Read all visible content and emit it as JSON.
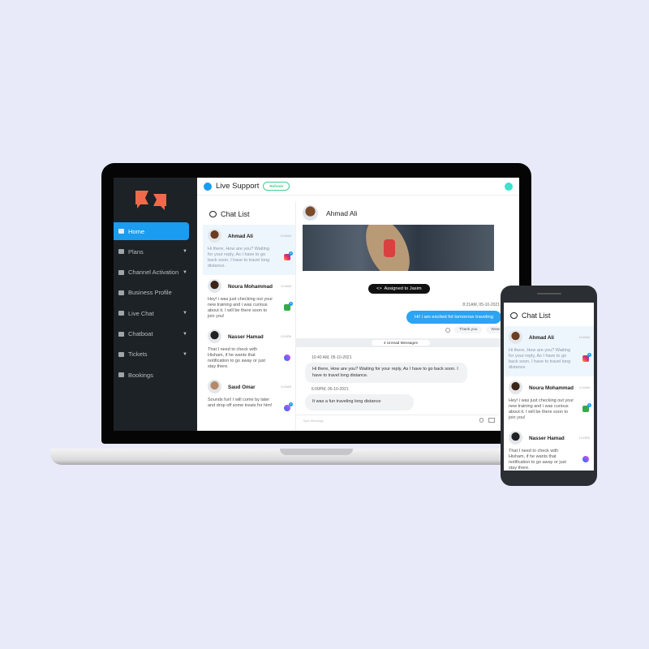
{
  "app": {
    "title": "Live Support",
    "refresh_label": "Refresh",
    "brand_color": "#1a9cf0",
    "logo_color": "#ef6a4a"
  },
  "sidebar": {
    "items": [
      {
        "label": "Home",
        "icon": "home-icon",
        "active": true,
        "caret": false
      },
      {
        "label": "Plans",
        "icon": "list-icon",
        "caret": true
      },
      {
        "label": "Channel Activation",
        "icon": "asterisk-icon",
        "caret": true
      },
      {
        "label": "Business Profile",
        "icon": "user-icon",
        "caret": false
      },
      {
        "label": "Live Chat",
        "icon": "chat-icon",
        "caret": true
      },
      {
        "label": "Chatboat",
        "icon": "list-icon",
        "caret": true
      },
      {
        "label": "Tickets",
        "icon": "ticket-icon",
        "caret": true
      },
      {
        "label": "Bookings",
        "icon": "tag-icon",
        "caret": false
      }
    ]
  },
  "chat_list": {
    "title": "Chat List",
    "items": [
      {
        "name": "Ahmad Ali",
        "time": "10:40AM",
        "message": "Hi there, How are you? Waiting for your reply, As I have to go back soon.  I have to travel long distance.",
        "channel": "instagram",
        "badge": "4",
        "selected": true,
        "avatar_color": "#6b3d22"
      },
      {
        "name": "Noura Mohammad",
        "time": "11:40AM",
        "message": "Hey! i was just checking out your new training and i was curious about it. I will be there soon to join you!",
        "channel": "whatsapp",
        "badge": "4",
        "avatar_color": "#3a2418"
      },
      {
        "name": "Nasser Hamad",
        "time": "12:04PM",
        "message": "That I need to check with Hisham, if he wants that notification to go away or just stay there.",
        "channel": "messenger",
        "avatar_color": "#222"
      },
      {
        "name": "Saud Omar",
        "time": "11:54AM",
        "message": "Sounds fun! I will come by later and drop off some treats for him!",
        "channel": "messenger",
        "badge": "4",
        "avatar_color": "#b58a6a"
      }
    ]
  },
  "conversation": {
    "contact": "Ahmad Ali",
    "assigned": "Assigned to Jasim",
    "outgoing": {
      "time": "8:21AM, 05-10-2021",
      "text": "Hi! i am excited fot tomorrow traveling"
    },
    "quick_replies": [
      "Thank you",
      "Wow"
    ],
    "unread": "4 Unread Messages",
    "incoming": [
      {
        "time": "10:40 AM, 05-10-2021",
        "text": "Hi there, How are you? Waiting for your reply, As I have to go back soon.  I have to travel long distance."
      },
      {
        "time": "6:00PM, 05-10-2021",
        "text": "It was a fun traveling long distance"
      }
    ],
    "input_placeholder": "Type Message"
  }
}
